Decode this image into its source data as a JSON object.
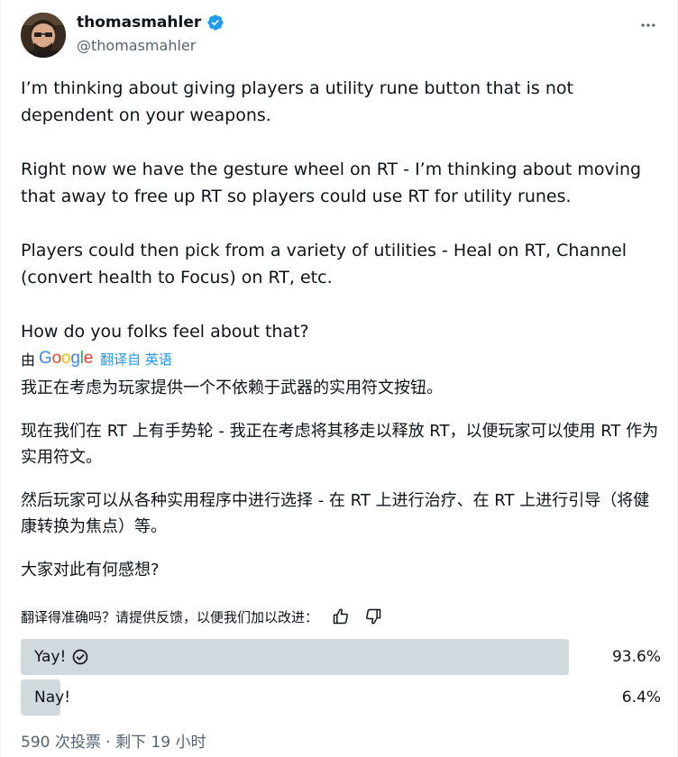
{
  "author": {
    "display_name": "thomasmahler",
    "handle": "@thomasmahler",
    "verified": true,
    "verified_color": "#1d9bf0"
  },
  "tweet": {
    "paragraphs": [
      "I’m thinking about giving players a utility rune button that is not dependent on your weapons.",
      "Right now we have the gesture wheel on RT - I’m thinking about moving that away to free up RT so players could use RT for utility runes.",
      "Players could then pick from a variety of utilities - Heal on RT, Channel (convert health to Focus) on RT, etc.",
      "How do you folks feel about that?"
    ]
  },
  "translation": {
    "by_label": "由",
    "google_letters": [
      "G",
      "o",
      "o",
      "g",
      "l",
      "e"
    ],
    "google_colors": [
      "#4285f4",
      "#ea4335",
      "#fbbc05",
      "#4285f4",
      "#34a853",
      "#ea4335"
    ],
    "source_lang_label": "翻译自 英语",
    "paragraphs": [
      "我正在考虑为玩家提供一个不依赖于武器的实用符文按钮。",
      "现在我们在 RT 上有手势轮 - 我正在考虑将其移走以释放 RT，以便玩家可以使用 RT 作为实用符文。",
      "然后玩家可以从各种实用程序中进行选择 - 在 RT 上进行治疗、在 RT 上进行引导（将健康转换为焦点）等。",
      "大家对此有何感想?"
    ],
    "feedback_prompt": "翻译得准确吗？请提供反馈，以便我们加以改进："
  },
  "poll": {
    "options": [
      {
        "label": "Yay!",
        "percent_text": "93.6%",
        "fraction": 0.936,
        "winner": true
      },
      {
        "label": "Nay!",
        "percent_text": "6.4%",
        "fraction": 0.064,
        "winner": false
      }
    ],
    "meta": "590 次投票 · 剩下 19 小时"
  },
  "icons": {
    "avatar": "avatar-image",
    "verified": "verified-badge-icon",
    "more": "more-options-icon",
    "thumbs_up": "thumbs-up-icon",
    "thumbs_down": "thumbs-down-icon",
    "winner": "check-circle-icon"
  }
}
